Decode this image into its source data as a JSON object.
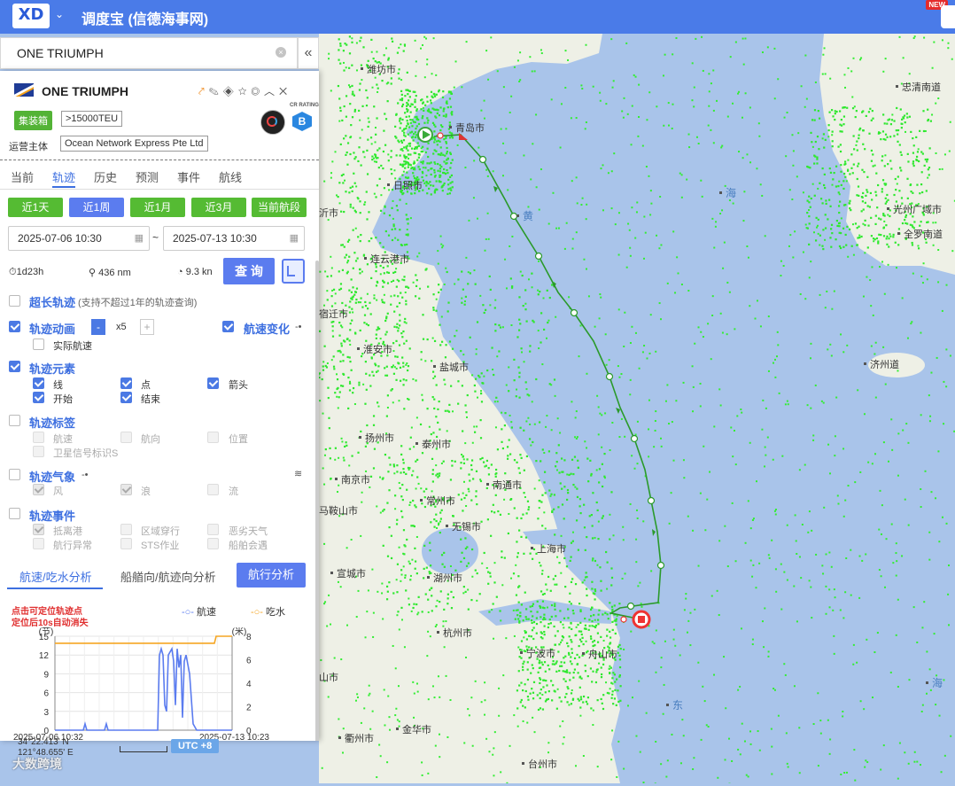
{
  "app": {
    "title": "调度宝 (信德海事网)",
    "logo": "XD",
    "new_badge": "NEW"
  },
  "search": {
    "value": "ONE TRIUMPH",
    "clear": "×",
    "collapse": "«"
  },
  "ship": {
    "name": "ONE TRIUMPH",
    "type_tag": "集装箱",
    "capacity_tag": ">15000TEU",
    "operator_label": "运营主体",
    "operator": "Ocean Network Express Pte Ltd",
    "cr_label": "CR RATING",
    "cr_grade": "B",
    "header_icons": "⤤ ✎ ◈ ☆ ◎ ︿ ✕"
  },
  "tabs": [
    "当前",
    "轨迹",
    "历史",
    "预测",
    "事件",
    "航线"
  ],
  "ranges": [
    "近1天",
    "近1周",
    "近1月",
    "近3月",
    "当前航段"
  ],
  "dates": {
    "start": "2025-07-06 10:30",
    "end": "2025-07-13 10:30",
    "sep": "~"
  },
  "stats": {
    "duration": "1d23h",
    "distance": "436 nm",
    "speed": "9.3 kn"
  },
  "query_button": "查 询",
  "options": {
    "long_track": "超长轨迹",
    "long_track_note": "(支持不超过1年的轨迹查询)",
    "animation": "轨迹动画",
    "speed_factor": "x5",
    "minus": "-",
    "plus": "+",
    "actual_speed": "实际航速",
    "speed_change": "航速变化",
    "elements": "轨迹元素",
    "el_line": "线",
    "el_point": "点",
    "el_arrow": "箭头",
    "el_start": "开始",
    "el_end": "结束",
    "labels": "轨迹标签",
    "lb_speed": "航速",
    "lb_course": "航向",
    "lb_position": "位置",
    "lb_sat": "卫星信号标识S",
    "weather": "轨迹气象",
    "w_wind": "风",
    "w_wave": "浪",
    "w_current": "流",
    "events": "轨迹事件",
    "ev_port": "抵离港",
    "ev_area": "区域穿行",
    "ev_weather": "恶劣天气",
    "ev_abnormal": "航行异常",
    "ev_sts": "STS作业",
    "ev_meet": "船舶会遇"
  },
  "analysis_tabs": {
    "speed_draft": "航速/吃水分析",
    "heading": "船艏向/航迹向分析",
    "nav": "航行分析"
  },
  "hint": [
    "点击可定位轨迹点",
    "定位后10s自动消失"
  ],
  "colors": {
    "primary": "#5b7cef",
    "green": "#55bb33",
    "speed_line": "#5b7cef",
    "draft_line": "#f5a623",
    "track": "#2a9a2a"
  },
  "chart_data": {
    "type": "line",
    "x": [
      "2025-07-06 10:32",
      "2025-07-13 10:23"
    ],
    "ylabel_left": "(节)",
    "ylabel_right": "(米)",
    "left_ticks": [
      0,
      3,
      6,
      9,
      12,
      15
    ],
    "right_ticks": [
      0,
      2,
      4,
      6,
      8
    ],
    "ylim_left": [
      0,
      15
    ],
    "ylim_right": [
      0,
      8
    ],
    "legend": [
      "航速",
      "吃水"
    ],
    "series": [
      {
        "name": "航速",
        "axis": "left",
        "t": [
          0,
          0.16,
          0.17,
          0.18,
          0.28,
          0.29,
          0.3,
          0.52,
          0.58,
          0.59,
          0.6,
          0.61,
          0.62,
          0.63,
          0.64,
          0.66,
          0.67,
          0.68,
          0.69,
          0.7,
          0.71,
          0.72,
          0.73,
          0.74,
          0.76,
          0.78,
          0.8,
          0.82,
          0.85,
          0.9,
          1.0
        ],
        "values": [
          0,
          0,
          1,
          0,
          0,
          1,
          0,
          0,
          0,
          12,
          13,
          12,
          4,
          3,
          12,
          13,
          11,
          4,
          13,
          10,
          12,
          2,
          11,
          12,
          9,
          1,
          0,
          0,
          0,
          0,
          0
        ]
      },
      {
        "name": "吃水",
        "axis": "right",
        "t": [
          0,
          0.9,
          0.91,
          1.0
        ],
        "values": [
          7.4,
          7.4,
          8.0,
          8.0
        ]
      }
    ]
  },
  "bottom": {
    "lat": "34°22.413' N",
    "lon": "121°48.655' E",
    "utc": "UTC +8",
    "watermark": "大数跨境",
    "scale": "30km"
  },
  "map_labels": [
    {
      "text": "潍坊市"
    },
    {
      "text": "青岛市"
    },
    {
      "text": "日照市"
    },
    {
      "text": "沂市"
    },
    {
      "text": "连云港市"
    },
    {
      "text": "宿迁市"
    },
    {
      "text": "淮安市"
    },
    {
      "text": "盐城市"
    },
    {
      "text": "扬州市"
    },
    {
      "text": "泰州市"
    },
    {
      "text": "南京市"
    },
    {
      "text": "南通市"
    },
    {
      "text": "常州市"
    },
    {
      "text": "马鞍山市"
    },
    {
      "text": "无锡市"
    },
    {
      "text": "上海市"
    },
    {
      "text": "宣城市"
    },
    {
      "text": "湖州市"
    },
    {
      "text": "杭州市"
    },
    {
      "text": "宁波市"
    },
    {
      "text": "舟山市"
    },
    {
      "text": "金华市"
    },
    {
      "text": "衢州市"
    },
    {
      "text": "台州市"
    },
    {
      "text": "忠清南道"
    },
    {
      "text": "光州广域市"
    },
    {
      "text": "全罗南道"
    },
    {
      "text": "济州道"
    },
    {
      "text": "海"
    },
    {
      "text": "黄"
    },
    {
      "text": "东"
    },
    {
      "text": "海"
    },
    {
      "text": "山市"
    }
  ]
}
